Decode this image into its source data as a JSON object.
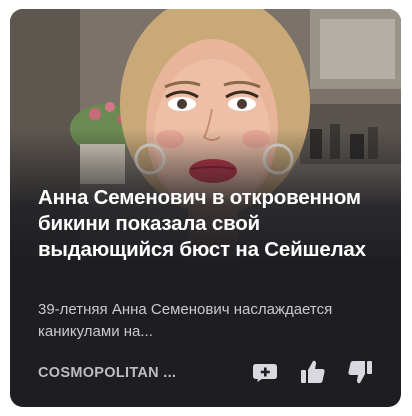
{
  "card": {
    "title": "Анна Семенович в откровенном бикини показала свой выдающийся бюст на Сейшелах",
    "snippet": "39-летняя Анна Семенович наслаждается каникулами на...",
    "source": "COSMOPOLITAN ...",
    "image_alt": "photo"
  },
  "icons": {
    "comment": "comment-plus-icon",
    "like": "thumbs-up-icon",
    "dislike": "thumbs-down-icon"
  },
  "colors": {
    "card_background": "#1d1d22",
    "title": "#ffffff",
    "snippet": "#c9c9cf",
    "source": "#bdbdc4",
    "icon": "#d8d8de"
  }
}
